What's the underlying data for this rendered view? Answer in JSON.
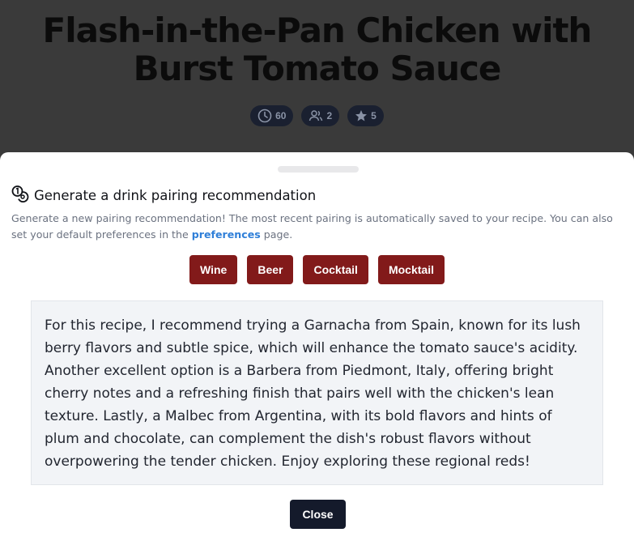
{
  "recipe": {
    "title": "Flash-in-the-Pan Chicken with Burst Tomato Sauce",
    "meta": [
      {
        "icon": "clock-icon",
        "value": "60"
      },
      {
        "icon": "users-icon",
        "value": "2"
      },
      {
        "icon": "star-icon",
        "value": "5"
      }
    ]
  },
  "modal": {
    "title": "Generate a drink pairing recommendation",
    "icon": "drink-pairing-icon",
    "description_before_link": "Generate a new pairing recommendation! The most recent pairing is automatically saved to your recipe. You can also set your default preferences in the ",
    "link_text": "preferences",
    "description_after_link": " page.",
    "drink_buttons": [
      "Wine",
      "Beer",
      "Cocktail",
      "Mocktail"
    ],
    "recommendation_text": "For this recipe, I recommend trying a Garnacha from Spain, known for its lush berry flavors and subtle spice, which will enhance the tomato sauce's acidity. Another excellent option is a Barbera from Piedmont, Italy, offering bright cherry notes and a refreshing finish that pairs well with the chicken's lean texture. Lastly, a Malbec from Argentina, with its bold flavors and hints of plum and chocolate, can complement the dish's robust flavors without overpowering the tender chicken. Enjoy exploring these regional reds!",
    "close_label": "Close"
  },
  "colors": {
    "drink_button": "#821a1a",
    "close_button": "#141a2b",
    "link": "#2f7fd8",
    "overlay": "#3a3a3a"
  }
}
